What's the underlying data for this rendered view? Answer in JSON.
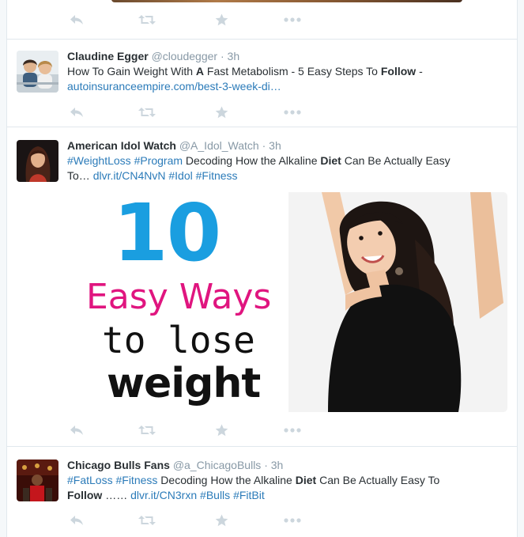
{
  "tweets": [
    {
      "id": "t0",
      "name": "",
      "handle": "",
      "time": ""
    },
    {
      "id": "t1",
      "name": "Claudine Egger",
      "handle": "@cloudegger",
      "sep": "·",
      "time": "3h",
      "text_parts": {
        "a": "How To Gain Weight With ",
        "b": "A",
        "c": " Fast Metabolism - 5 Easy Steps To ",
        "d": "Follow",
        "e": " -",
        "link": "autoinsuranceempire.com/best-3-week-di…"
      }
    },
    {
      "id": "t2",
      "name": "American Idol Watch",
      "handle": "@A_Idol_Watch",
      "sep": "·",
      "time": "3h",
      "text_parts": {
        "h1": "#WeightLoss",
        "h2": "#Program",
        "a": " Decoding How the Alkaline ",
        "b": "Diet",
        "c": " Can Be Actually Easy",
        "d": "To…",
        "link": "dlvr.it/CN4NvN",
        "h3": "#Idol",
        "h4": "#Fitness"
      },
      "media": {
        "number": "10",
        "line1": "Easy Ways",
        "line2": "to lose",
        "line3": "weight"
      }
    },
    {
      "id": "t3",
      "name": "Chicago Bulls Fans",
      "handle": "@a_ChicagoBulls",
      "sep": "·",
      "time": "3h",
      "text_parts": {
        "h1": "#FatLoss",
        "h2": "#Fitness",
        "a": " Decoding How the Alkaline ",
        "b": "Diet",
        "c": " Can Be Actually Easy To",
        "d": "Follow",
        "e": " ……",
        "link": "dlvr.it/CN3rxn",
        "h3": "#Bulls",
        "h4": "#FitBit"
      }
    }
  ],
  "icons": {
    "reply": "reply-icon",
    "retweet": "retweet-icon",
    "favorite": "star-icon",
    "more": "more-dots-icon"
  },
  "colors": {
    "link": "#2b7bb9",
    "muted": "#8899a6",
    "action": "#ccd6dd",
    "number_blue": "#1a9ee0",
    "pink": "#e0157f"
  }
}
